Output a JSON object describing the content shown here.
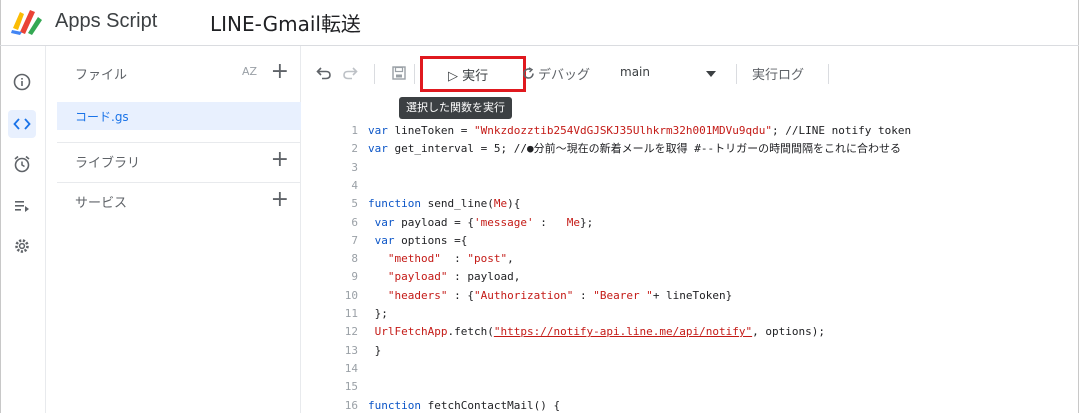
{
  "header": {
    "product_name": "Apps Script",
    "project_title": "LINE-Gmail転送"
  },
  "rail": {
    "items": [
      {
        "icon": "info-icon"
      },
      {
        "icon": "code-icon",
        "active": true
      },
      {
        "icon": "alarm-icon"
      },
      {
        "icon": "executions-icon"
      },
      {
        "icon": "settings-icon"
      }
    ]
  },
  "files_panel": {
    "files_label": "ファイル",
    "sort_label": "AZ",
    "add_symbol": "+",
    "active_file": "コード.gs",
    "libraries_label": "ライブラリ",
    "services_label": "サービス"
  },
  "toolbar": {
    "undo_icon": "undo-icon",
    "redo_icon": "redo-icon",
    "save_icon": "save-icon",
    "run_label": "▷ 実行",
    "debug_label": "デバッグ",
    "function_select": "main",
    "log_label": "実行ログ",
    "run_tooltip": "選択した関数を実行"
  },
  "code": [
    {
      "n": "1",
      "parts": [
        [
          "kw",
          "var "
        ],
        [
          "fn",
          "lineToken = "
        ],
        [
          "str",
          "\"Wnkzdozztib254VdGJSKJ35Ulhkrm32h001MDVu9qdu\""
        ],
        [
          "fn",
          "; //LINE notify token"
        ]
      ]
    },
    {
      "n": "2",
      "parts": [
        [
          "kw",
          "var "
        ],
        [
          "fn",
          "get_interval = 5; //●分前～現在の新着メールを取得 #--トリガーの時間間隔をこれに合わせる"
        ]
      ]
    },
    {
      "n": "3",
      "parts": []
    },
    {
      "n": "4",
      "parts": []
    },
    {
      "n": "5",
      "parts": [
        [
          "kw",
          "function "
        ],
        [
          "fn",
          "send_line("
        ],
        [
          "prm",
          "Me"
        ],
        [
          "fn",
          "){"
        ]
      ]
    },
    {
      "n": "6",
      "parts": [
        [
          "kw",
          " var "
        ],
        [
          "fn",
          "payload = {"
        ],
        [
          "str",
          "'message'"
        ],
        [
          "fn",
          " :   "
        ],
        [
          "prm",
          "Me"
        ],
        [
          "fn",
          "};"
        ]
      ]
    },
    {
      "n": "7",
      "parts": [
        [
          "kw",
          " var "
        ],
        [
          "fn",
          "options ={"
        ]
      ]
    },
    {
      "n": "8",
      "parts": [
        [
          "str",
          "   \"method\""
        ],
        [
          "fn",
          "  : "
        ],
        [
          "str",
          "\"post\""
        ],
        [
          "fn",
          ","
        ]
      ]
    },
    {
      "n": "9",
      "parts": [
        [
          "str",
          "   \"payload\""
        ],
        [
          "fn",
          " : payload,"
        ]
      ]
    },
    {
      "n": "10",
      "parts": [
        [
          "str",
          "   \"headers\""
        ],
        [
          "fn",
          " : {"
        ],
        [
          "str",
          "\"Authorization\""
        ],
        [
          "fn",
          " : "
        ],
        [
          "str",
          "\"Bearer \""
        ],
        [
          "fn",
          "+ lineToken}"
        ]
      ]
    },
    {
      "n": "11",
      "parts": [
        [
          "fn",
          " };"
        ]
      ]
    },
    {
      "n": "12",
      "parts": [
        [
          "prm",
          " UrlFetchApp"
        ],
        [
          "fn",
          ".fetch("
        ],
        [
          "url",
          "\"https://notify-api.line.me/api/notify\""
        ],
        [
          "fn",
          ", options);"
        ]
      ]
    },
    {
      "n": "13",
      "parts": [
        [
          "fn",
          " }"
        ]
      ]
    },
    {
      "n": "14",
      "parts": []
    },
    {
      "n": "15",
      "parts": []
    },
    {
      "n": "16",
      "parts": [
        [
          "kw",
          "function "
        ],
        [
          "fn",
          "fetchContactMail() {"
        ]
      ]
    }
  ]
}
